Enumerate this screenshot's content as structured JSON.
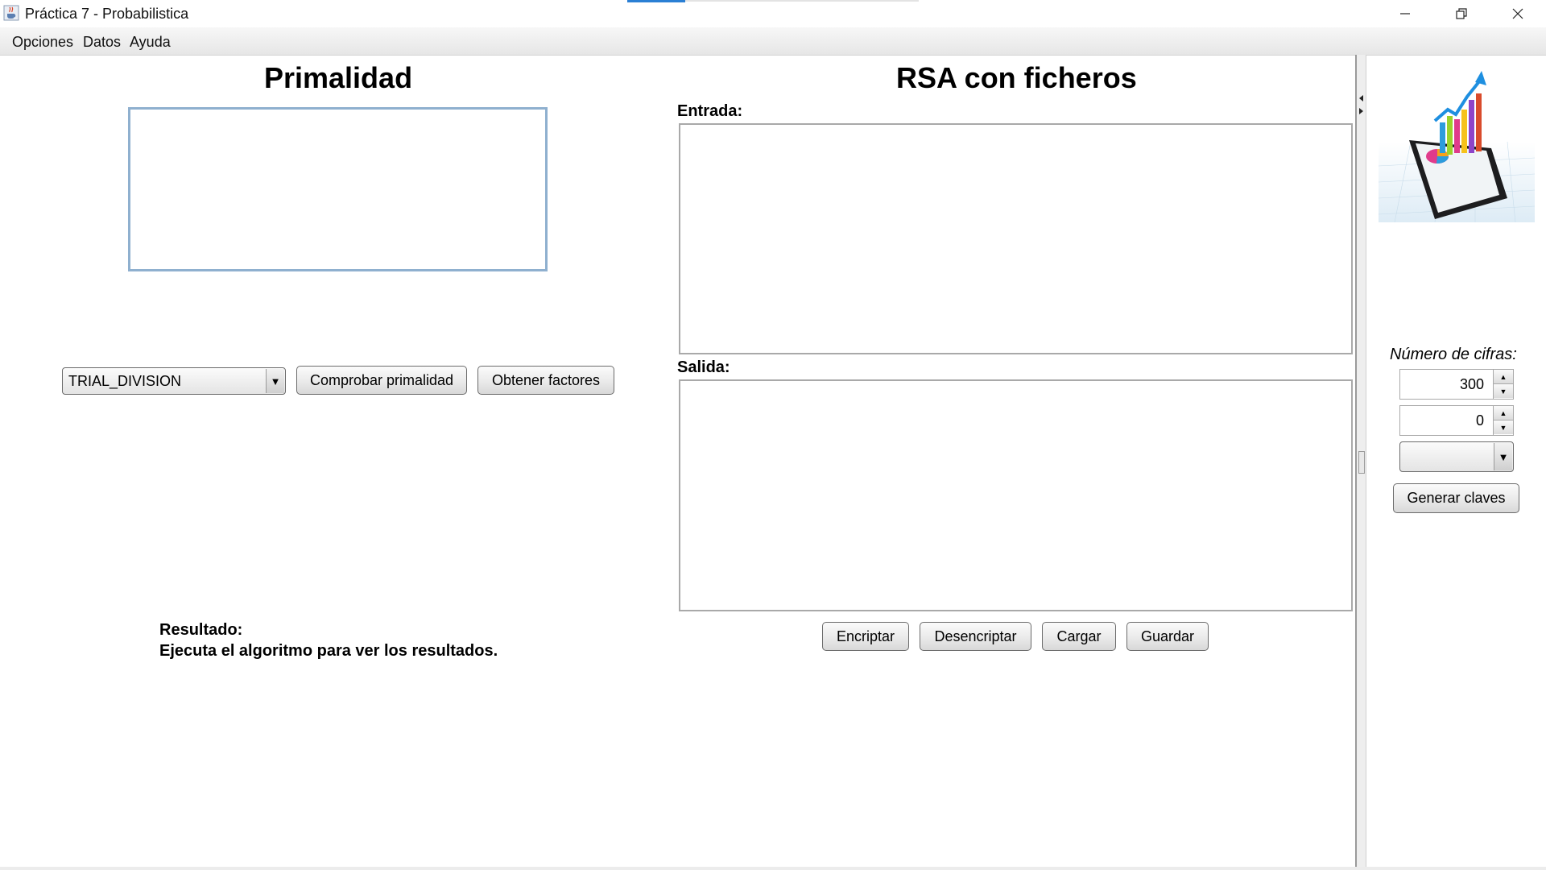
{
  "window": {
    "title": "Práctica 7 - Probabilistica",
    "app_icon": "java-cup-icon",
    "controls": [
      "minimize-icon",
      "restore-icon",
      "close-icon"
    ]
  },
  "menu": {
    "items": [
      {
        "label": "Opciones"
      },
      {
        "label": "Datos"
      },
      {
        "label": "Ayuda"
      }
    ]
  },
  "primalidad": {
    "title": "Primalidad",
    "algorithm": {
      "selected": "TRIAL_DIVISION"
    },
    "check_button": "Comprobar primalidad",
    "factor_button": "Obtener factores",
    "result_label": "Resultado:",
    "result_text": "Ejecuta el algoritmo para ver los resultados."
  },
  "rsa": {
    "title": "RSA con ficheros",
    "input_label": "Entrada:",
    "output_label": "Salida:",
    "buttons": {
      "encrypt": "Encriptar",
      "decrypt": "Desencriptar",
      "load": "Cargar",
      "save": "Guardar"
    }
  },
  "side_panel": {
    "image_icon": "analytics-tablet-chart-icon",
    "digits_label": "Número de cifras:",
    "digits_value": "300",
    "second_value": "0",
    "combo_selected": "",
    "generate_button": "Generar claves"
  },
  "colors": {
    "text_area_focus_border": "#8fb0cf",
    "title_accent": "#2a7fd4"
  }
}
